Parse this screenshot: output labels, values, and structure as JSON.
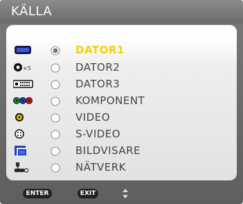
{
  "window": {
    "title": "KÄLLA"
  },
  "sources": [
    {
      "label": "DATOR1",
      "icon": "vga-connector-icon",
      "selected": true
    },
    {
      "label": "DATOR2",
      "icon": "bnc-x5-connector-icon",
      "icon_text": "×5",
      "selected": false
    },
    {
      "label": "DATOR3",
      "icon": "dvi-connector-icon",
      "selected": false
    },
    {
      "label": "KOMPONENT",
      "icon": "component-rca-icon",
      "selected": false
    },
    {
      "label": "VIDEO",
      "icon": "composite-video-icon",
      "selected": false
    },
    {
      "label": "S-VIDEO",
      "icon": "s-video-connector-icon",
      "selected": false
    },
    {
      "label": "BILDVISARE",
      "icon": "viewer-icon",
      "selected": false
    },
    {
      "label": "NÄTVERK",
      "icon": "network-icon",
      "selected": false
    }
  ],
  "footer": {
    "enter_label": "ENTER",
    "exit_label": "EXIT",
    "updown_icon": "up-down-arrows-icon"
  },
  "colors": {
    "selected_text": "#f2d300",
    "text": "#444444",
    "panel": "#eeeeee",
    "frame": "#6b6b6b"
  }
}
